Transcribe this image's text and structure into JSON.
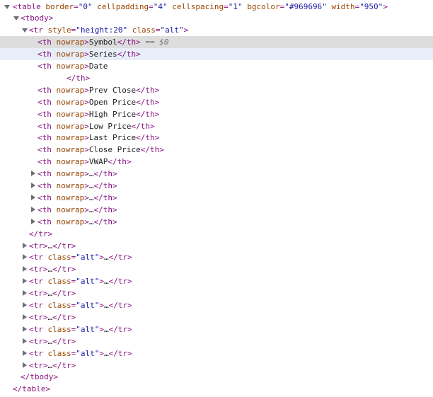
{
  "nodes": [
    {
      "tag_open": "<table",
      "attrs": [
        {
          "name": "border",
          "value": "\"0\""
        },
        {
          "name": "cellpadding",
          "value": "\"4\""
        },
        {
          "name": "cellspacing",
          "value": "\"1\""
        },
        {
          "name": "bgcolor",
          "value": "\"#969696\""
        },
        {
          "name": "width",
          "value": "\"950\""
        }
      ],
      "tag_end": ">"
    },
    {
      "tag_open": "<tbody>"
    },
    {
      "tag_open": "<tr",
      "attrs": [
        {
          "name": "style",
          "value": "\"height:20\""
        },
        {
          "name": "class",
          "value": "\"alt\""
        }
      ],
      "tag_end": ">"
    },
    {
      "th_text": "Symbol",
      "selected_marker": "== $0"
    },
    {
      "th_text": "Series"
    },
    {
      "th_text": "Date"
    },
    {
      "closing": "</th>"
    },
    {
      "th_text": "Prev Close"
    },
    {
      "th_text": "Open Price"
    },
    {
      "th_text": "High Price"
    },
    {
      "th_text": "Low Price"
    },
    {
      "th_text": "Last Price"
    },
    {
      "th_text": "Close Price"
    },
    {
      "th_text": "VWAP"
    },
    {
      "th_collapsed": "…"
    },
    {
      "th_collapsed": "…"
    },
    {
      "th_collapsed": "…"
    },
    {
      "th_collapsed": "…"
    },
    {
      "th_collapsed": "…"
    },
    {
      "closing": "</tr>"
    },
    {
      "tr_collapsed": "…"
    },
    {
      "tr_alt_collapsed": "…",
      "class_value": "\"alt\""
    },
    {
      "tr_collapsed": "…"
    },
    {
      "tr_alt_collapsed": "…",
      "class_value": "\"alt\""
    },
    {
      "tr_collapsed": "…"
    },
    {
      "tr_alt_collapsed": "…",
      "class_value": "\"alt\""
    },
    {
      "tr_collapsed": "…"
    },
    {
      "tr_alt_collapsed": "…",
      "class_value": "\"alt\""
    },
    {
      "tr_collapsed": "…"
    },
    {
      "tr_alt_collapsed": "…",
      "class_value": "\"alt\""
    },
    {
      "tr_collapsed": "…"
    },
    {
      "closing": "</tbody>"
    },
    {
      "closing": "</table>"
    }
  ],
  "strings": {
    "th_open": "<th",
    "nowrap": "nowrap",
    "gt": ">",
    "th_close": "</th>",
    "tr_open": "<tr",
    "tr_close": "</tr>",
    "class_attr": "class",
    "eq": "="
  }
}
